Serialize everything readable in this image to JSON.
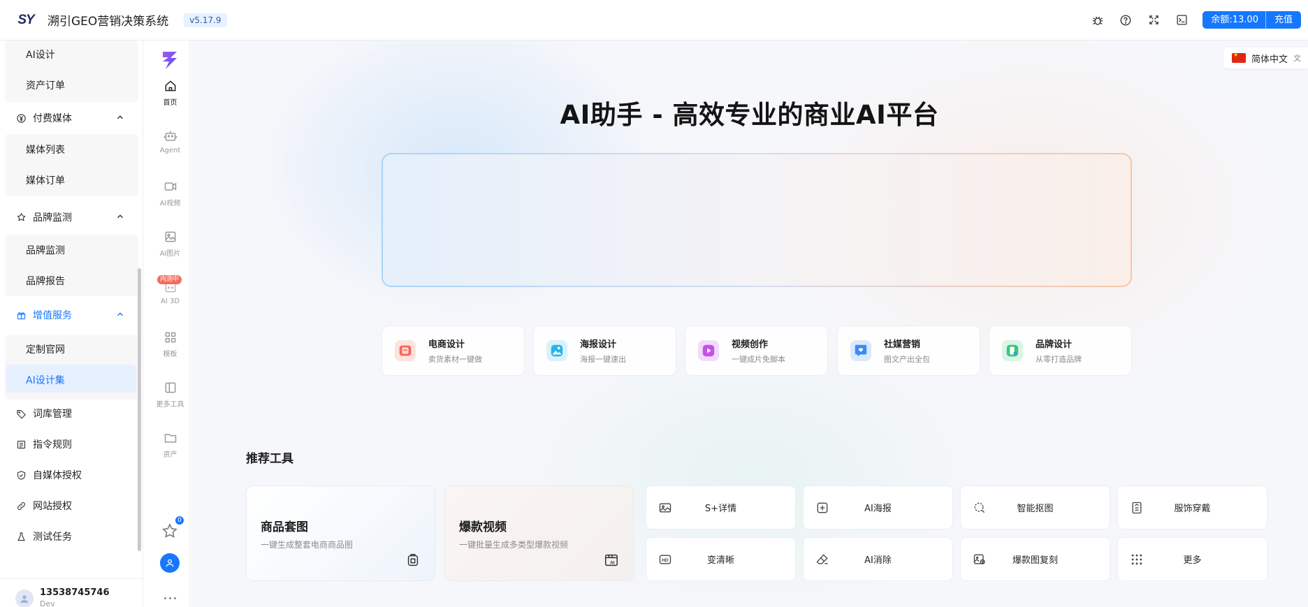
{
  "header": {
    "logo_text": "SY",
    "title": "溯引GEO营销决策系统",
    "version": "v5.17.9",
    "icons": [
      "bug-icon",
      "help-icon",
      "fullscreen-icon",
      "terminal-icon"
    ],
    "balance_label": "余额:13.00",
    "recharge_label": "充值",
    "accent_color": "#1677ff"
  },
  "sidebar": {
    "items": [
      {
        "label": "AI设计",
        "level": "sub"
      },
      {
        "label": "资产订单",
        "level": "sub"
      },
      {
        "label": "付费媒体",
        "level": "top",
        "icon": "yen-circle-icon",
        "expanded": true
      },
      {
        "label": "媒体列表",
        "level": "sub"
      },
      {
        "label": "媒体订单",
        "level": "sub"
      },
      {
        "label": "品牌监测",
        "level": "top",
        "icon": "brand-icon",
        "expanded": true
      },
      {
        "label": "品牌监测",
        "level": "sub"
      },
      {
        "label": "品牌报告",
        "level": "sub"
      },
      {
        "label": "增值服务",
        "level": "top",
        "icon": "gift-icon",
        "expanded": true,
        "active": true
      },
      {
        "label": "定制官网",
        "level": "sub"
      },
      {
        "label": "AI设计集",
        "level": "sub",
        "selected": true
      },
      {
        "label": "词库管理",
        "level": "top",
        "icon": "tag-icon"
      },
      {
        "label": "指令规则",
        "level": "top",
        "icon": "rules-icon"
      },
      {
        "label": "自媒体授权",
        "level": "top",
        "icon": "shield-check-icon"
      },
      {
        "label": "网站授权",
        "level": "top",
        "icon": "link-icon"
      },
      {
        "label": "测试任务",
        "level": "top",
        "icon": "flask-icon"
      }
    ],
    "user": {
      "phone": "13538745746",
      "role": "Dev"
    }
  },
  "rail": {
    "items": [
      {
        "label": "首页",
        "icon": "home-icon",
        "active": true
      },
      {
        "label": "Agent",
        "icon": "robot-icon"
      },
      {
        "label": "AI视频",
        "icon": "video-icon"
      },
      {
        "label": "AI图片",
        "icon": "image-icon"
      },
      {
        "label": "AI 3D",
        "icon": "cube-icon",
        "badge": "内测中"
      },
      {
        "label": "模板",
        "icon": "grid-icon"
      },
      {
        "label": "更多工具",
        "icon": "panel-icon"
      },
      {
        "label": "资产",
        "icon": "folder-icon"
      }
    ],
    "favorites_count": "0"
  },
  "main": {
    "language": "简体中文",
    "hero_title": "AI助手 - 高效专业的商业AI平台",
    "prompt_placeholder": "",
    "categories": [
      {
        "title": "电商设计",
        "desc": "卖货素材一键做",
        "icon": "shopping-bag-icon",
        "color": "#f5655a"
      },
      {
        "title": "海报设计",
        "desc": "海报一键速出",
        "icon": "poster-icon",
        "color": "#29b6e8"
      },
      {
        "title": "视频创作",
        "desc": "一键成片免脚本",
        "icon": "play-icon",
        "color": "#c552e8"
      },
      {
        "title": "社媒营销",
        "desc": "图文产出全包",
        "icon": "heart-chat-icon",
        "color": "#3c8cf2"
      },
      {
        "title": "品牌设计",
        "desc": "从零打造品牌",
        "icon": "brand-design-icon",
        "color": "#3cc67a"
      }
    ],
    "recommended_title": "推荐工具",
    "big_tools": [
      {
        "title": "商品套图",
        "desc": "一键生成整套电商商品图",
        "icon": "product-set-icon"
      },
      {
        "title": "爆款视频",
        "desc": "一键批量生成多类型爆款视频",
        "icon": "ai-video-icon"
      }
    ],
    "tools": [
      {
        "label": "S+详情",
        "icon": "detail-image-icon"
      },
      {
        "label": "AI海报",
        "icon": "plus-square-icon"
      },
      {
        "label": "智能抠图",
        "icon": "cutout-icon"
      },
      {
        "label": "服饰穿戴",
        "icon": "clothing-icon"
      },
      {
        "label": "变清晰",
        "icon": "hd-icon"
      },
      {
        "label": "AI消除",
        "icon": "eraser-icon"
      },
      {
        "label": "爆款图复刻",
        "icon": "copy-image-icon"
      },
      {
        "label": "更多",
        "icon": "dots-grid-icon"
      }
    ]
  }
}
